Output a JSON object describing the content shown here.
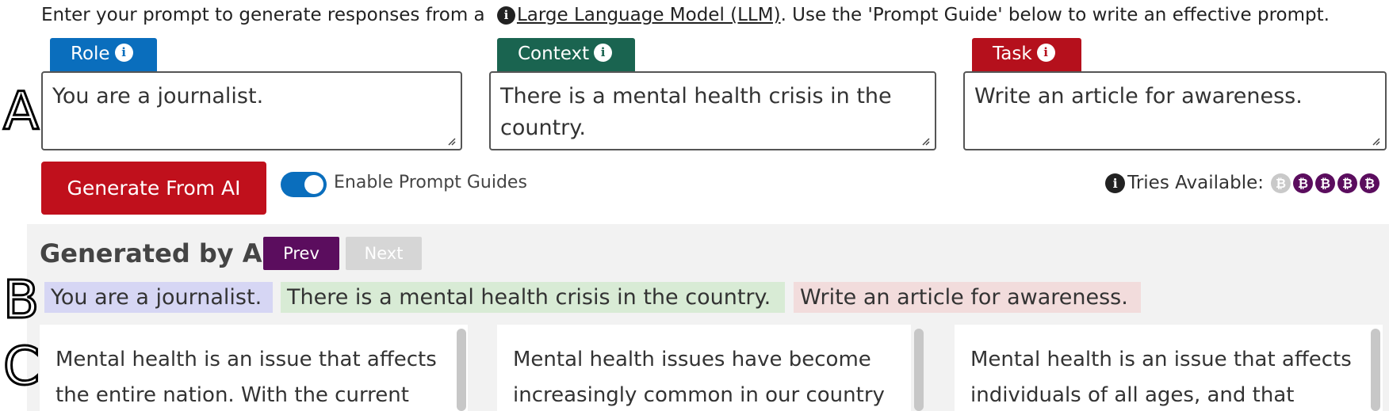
{
  "intro": {
    "before": "Enter your prompt to generate responses from a ",
    "link": "Large Language Model (LLM)",
    "after": ". Use the 'Prompt Guide' below to write an effective prompt."
  },
  "labels": {
    "a": "A",
    "b": "B",
    "c": "C"
  },
  "prompt": {
    "role": {
      "label": "Role",
      "value": "You are a journalist."
    },
    "context": {
      "label": "Context",
      "value": "There is a mental health crisis in the country."
    },
    "task": {
      "label": "Task",
      "value": "Write an article for awareness."
    }
  },
  "controls": {
    "generate_label": "Generate From AI",
    "toggle_label": "Enable Prompt Guides",
    "toggle_on": true,
    "tries_label": "Tries Available:",
    "tries_used": 1,
    "tries_available": 4
  },
  "generated": {
    "title": "Generated by AI",
    "prev_label": "Prev",
    "next_label": "Next",
    "chips": {
      "role": "You are a journalist.",
      "context": "There is a mental health crisis in the country.",
      "task": "Write an article for awareness."
    },
    "responses": [
      "Mental health is an issue that affects the entire nation. With the current",
      "Mental health issues have become increasingly common in our country",
      "Mental health is an issue that affects individuals of all ages, and that"
    ]
  },
  "colors": {
    "role": "#0a6ebd",
    "context": "#1a6450",
    "task": "#b5101c",
    "generate": "#c0101c",
    "prev": "#5b0d5e",
    "coin_available": "#5b0d5e",
    "coin_used": "#c9c9c9"
  },
  "icons": {
    "info": "info-circle-icon",
    "coin": "bitcoin-coin-icon",
    "resize": "resize-grip-icon"
  }
}
